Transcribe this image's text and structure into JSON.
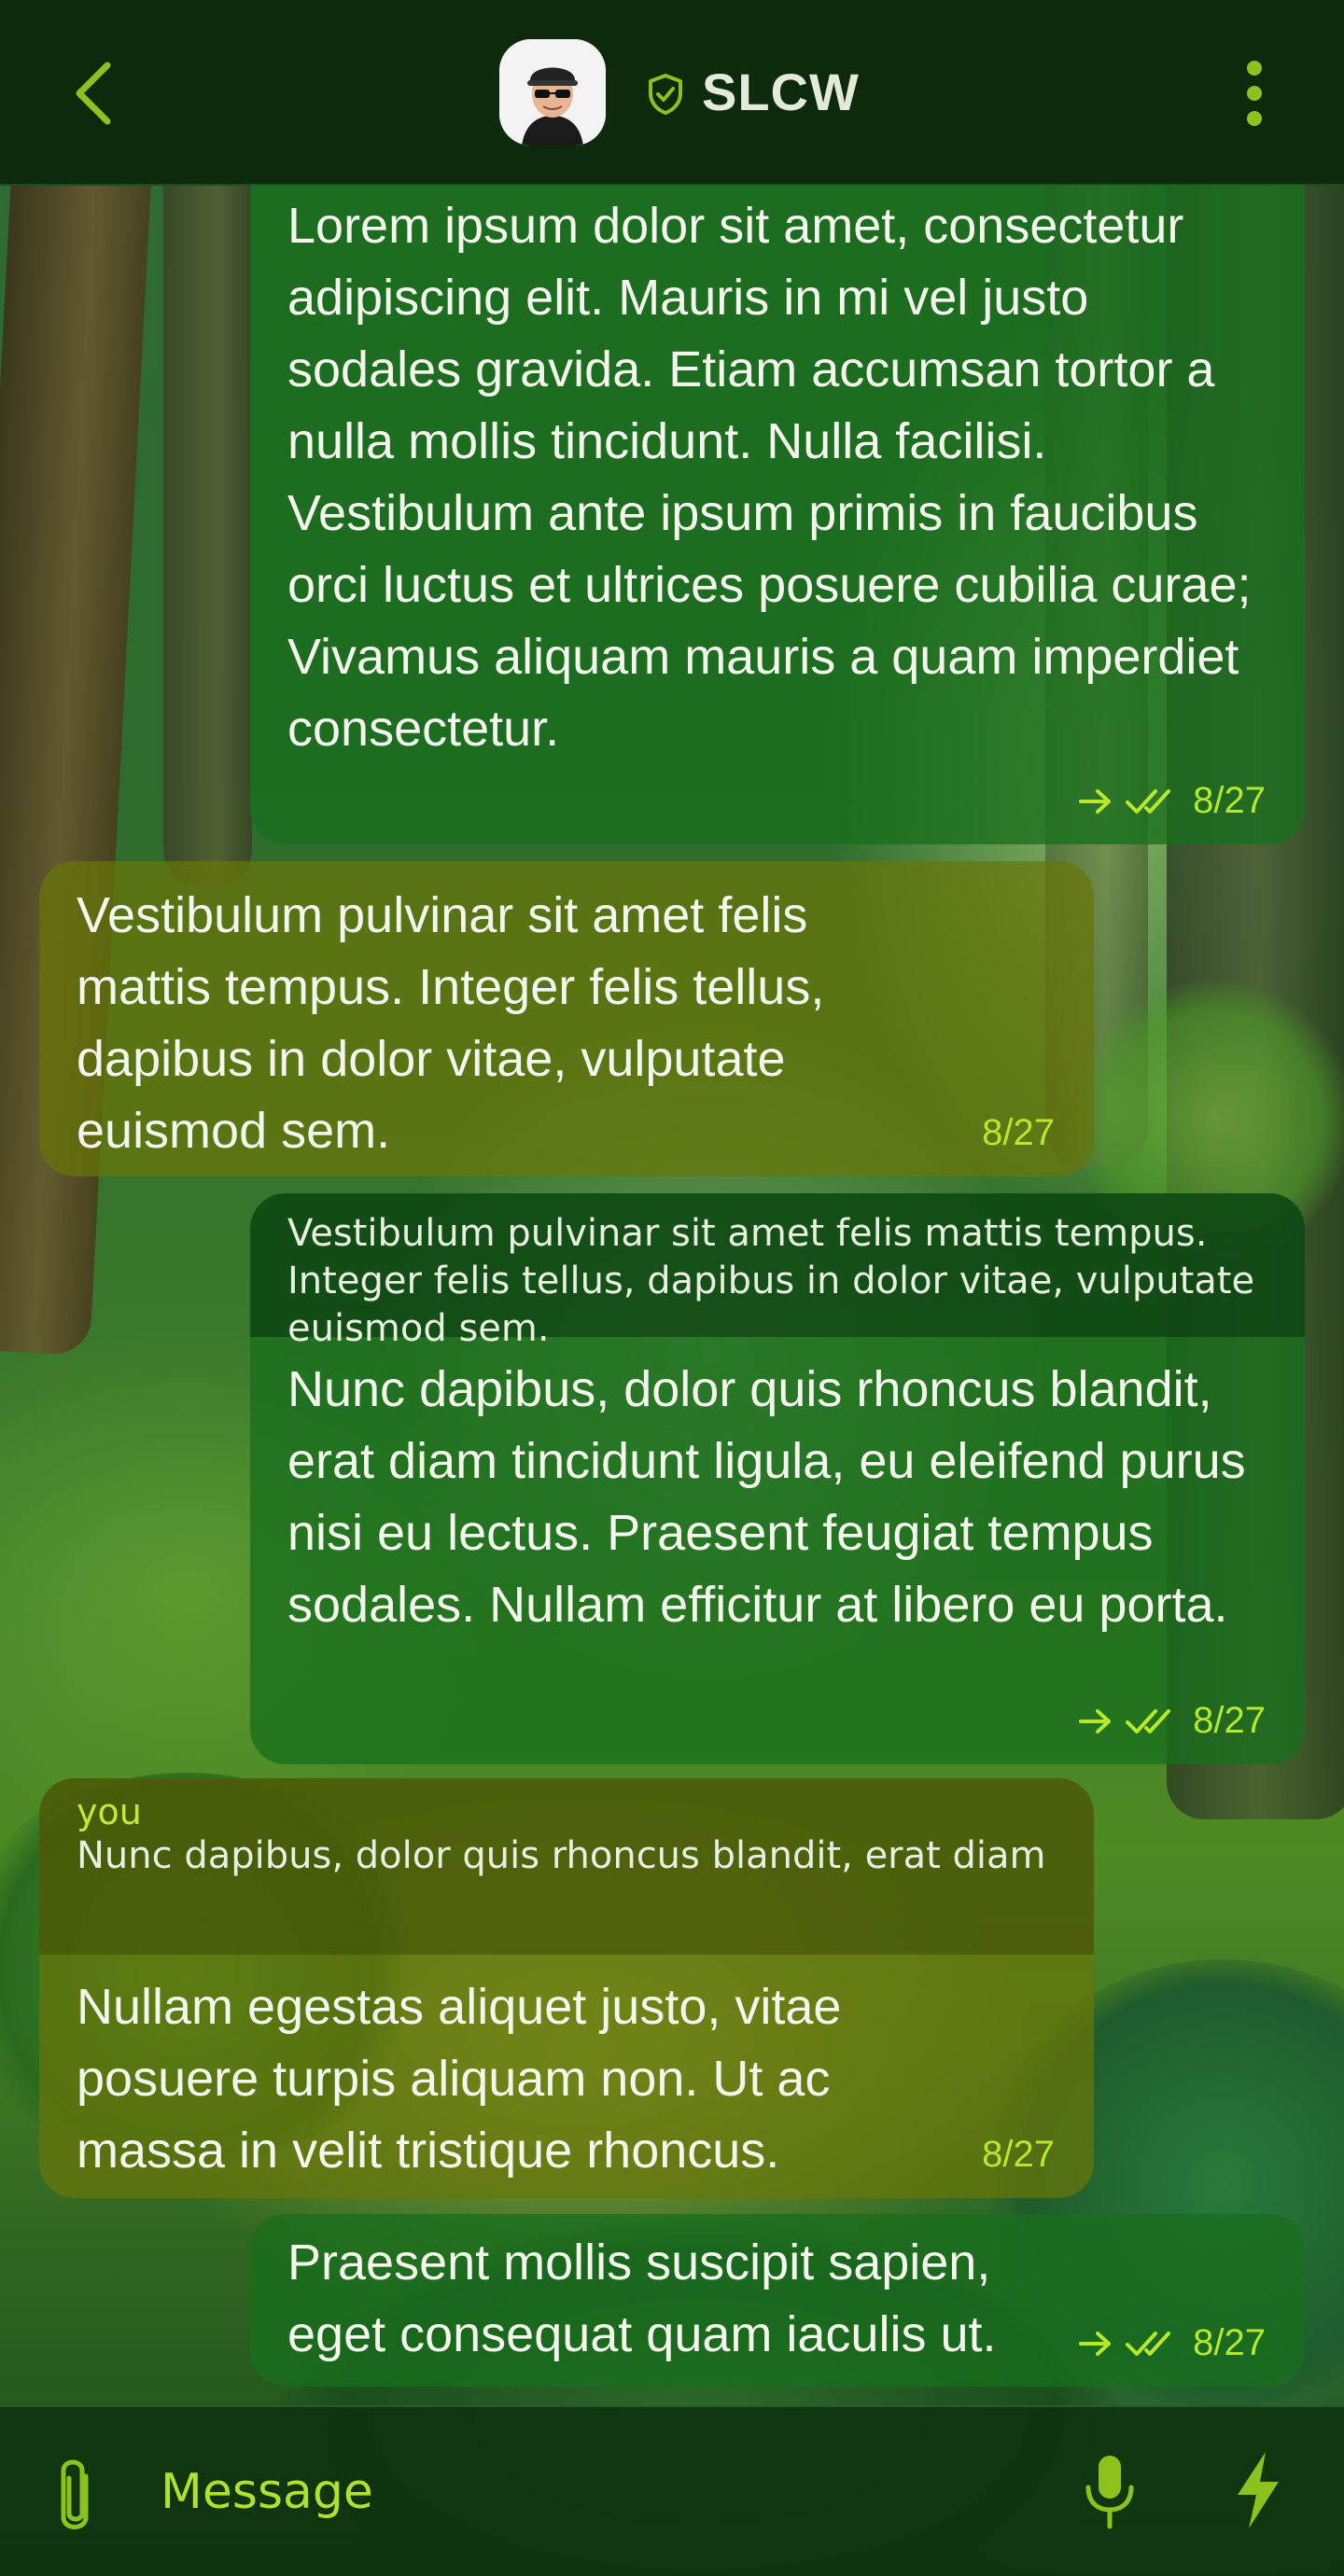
{
  "header": {
    "title": "SLCW",
    "back_icon": "chevron-left-icon",
    "verified_icon": "shield-check-icon",
    "menu_icon": "more-vertical-icon"
  },
  "messages": [
    {
      "direction": "outgoing",
      "text": "Lorem ipsum dolor sit amet, consectetur adipiscing elit. Mauris in mi vel justo sodales gravida. Etiam accumsan tortor a nulla mollis tincidunt. Nulla facilisi. Vestibulum ante ipsum primis in faucibus orci luctus et ultrices posuere cubilia curae; Vivamus aliquam mauris a quam imperdiet consectetur.",
      "time": "8/27",
      "status": "read"
    },
    {
      "direction": "incoming",
      "text": "Vestibulum pulvinar sit amet felis mattis tempus. Integer felis tellus, dapibus in dolor vitae, vulputate euismod sem.",
      "time": "8/27"
    },
    {
      "direction": "outgoing",
      "reply": "Vestibulum pulvinar sit amet felis mattis tempus. Integer felis tellus, dapibus in dolor vitae, vulputate euismod sem.",
      "text": "Nunc dapibus, dolor quis rhoncus blandit, erat diam tincidunt ligula, eu eleifend purus nisi eu lectus. Praesent feugiat tempus sodales. Nullam efficitur at libero eu porta.",
      "time": "8/27",
      "status": "read"
    },
    {
      "direction": "incoming",
      "reply_author": "you",
      "reply": "Nunc dapibus, dolor quis rhoncus blandit, erat diam tincidunt ligula, eu eleifend purus ...",
      "text": "Nullam egestas aliquet justo, vitae posuere turpis aliquam non. Ut ac massa in velit tristique rhoncus.",
      "time": "8/27"
    },
    {
      "direction": "outgoing",
      "text": "Praesent mollis suscipit sapien, eget consequat quam iaculis ut.",
      "time": "8/27",
      "status": "read"
    }
  ],
  "composer": {
    "placeholder": "Message",
    "attach_icon": "paperclip-icon",
    "mic_icon": "microphone-icon",
    "send_icon": "lightning-bolt-icon"
  },
  "colors": {
    "accent": "#8dc21c",
    "header_bg": "#0c2a0c",
    "outgoing_bubble": "#186e1c",
    "incoming_bubble": "#68760a"
  }
}
